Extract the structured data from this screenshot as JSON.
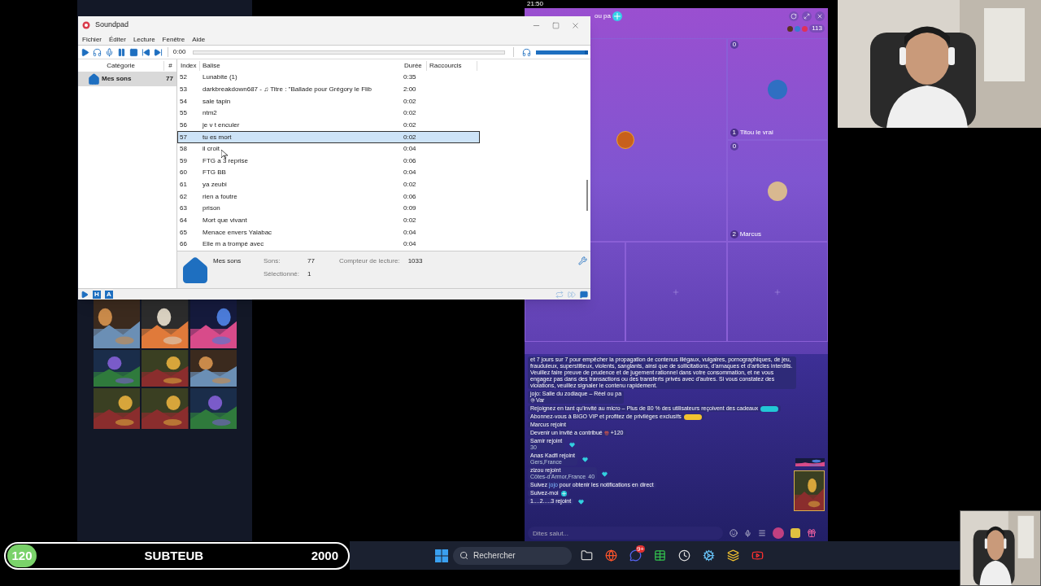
{
  "status_time": "21:50",
  "soundpad": {
    "title": "Soundpad",
    "menu": [
      "Fichier",
      "Éditer",
      "Lecture",
      "Fenêtre",
      "Aide"
    ],
    "toolbar": [
      {
        "kind": "play"
      },
      {
        "kind": "headphones"
      },
      {
        "kind": "mic"
      },
      {
        "kind": "pause"
      },
      {
        "kind": "stop"
      },
      {
        "kind": "previous"
      },
      {
        "kind": "next"
      }
    ],
    "time": "0:00",
    "volume": {
      "level": 1
    },
    "category_columns": [
      "Catégorie",
      "#"
    ],
    "categories": [
      {
        "name": "Mes sons",
        "count": "77",
        "selected": true
      }
    ],
    "columns": [
      "Index",
      "Balise",
      "Durée",
      "Raccourcis"
    ],
    "rows": [
      {
        "index": "52",
        "tag": "Lunabite (1)",
        "duration": "0:35",
        "selected": false
      },
      {
        "index": "53",
        "tag": "darkbreakdown687 - ♫ Titre : \"Ballade pour Grégory le Flib",
        "duration": "2:00",
        "selected": false
      },
      {
        "index": "54",
        "tag": "sale tapin",
        "duration": "0:02",
        "selected": false
      },
      {
        "index": "55",
        "tag": "ntm2",
        "duration": "0:02",
        "selected": false
      },
      {
        "index": "56",
        "tag": "je v t enculer",
        "duration": "0:02",
        "selected": false
      },
      {
        "index": "57",
        "tag": "tu es mort",
        "duration": "0:02",
        "selected": true
      },
      {
        "index": "58",
        "tag": "il croit",
        "duration": "0:04",
        "selected": false
      },
      {
        "index": "59",
        "tag": "FTG a 3 reprise",
        "duration": "0:06",
        "selected": false
      },
      {
        "index": "60",
        "tag": "FTG BB",
        "duration": "0:04",
        "selected": false
      },
      {
        "index": "61",
        "tag": "ya zeubi",
        "duration": "0:02",
        "selected": false
      },
      {
        "index": "62",
        "tag": "rien a foutre",
        "duration": "0:06",
        "selected": false
      },
      {
        "index": "63",
        "tag": "prison",
        "duration": "0:09",
        "selected": false
      },
      {
        "index": "64",
        "tag": "Mort que vivant",
        "duration": "0:02",
        "selected": false
      },
      {
        "index": "65",
        "tag": "Menace envers Yalabac",
        "duration": "0:04",
        "selected": false
      },
      {
        "index": "66",
        "tag": "Elle m a trompé avec",
        "duration": "0:04",
        "selected": false
      }
    ],
    "footer": {
      "category": "Mes sons",
      "stats": [
        {
          "label": "Sons:",
          "value": "77"
        },
        {
          "label": "Compteur de lecture:",
          "value": "1033"
        },
        {
          "label": "Sélectionné:",
          "value": "1"
        }
      ]
    },
    "status_buttons": [
      {
        "kind": "play"
      },
      {
        "kind": "letter",
        "label": "H"
      },
      {
        "kind": "letter",
        "label": "A"
      }
    ]
  },
  "live_room": {
    "title": "ou pa",
    "viewer_count": "113",
    "tiles": [
      {
        "kind": "host"
      },
      {
        "kind": "guest",
        "name": "Titou le vrai",
        "score": "0",
        "seat": "1"
      },
      {
        "kind": "guest",
        "name": "Marcus",
        "score": "0",
        "seat": "2"
      },
      {
        "kind": "covered"
      },
      {
        "kind": "empty"
      },
      {
        "kind": "empty"
      }
    ],
    "chat": [
      {
        "kind": "notice",
        "text": "et 7 jours sur 7 pour empêcher la propagation de contenus illégaux, vulgaires, pornographiques, de jeu, frauduleux, superstitieux, violents, sanglants, ainsi que de sollicitations, d'arnaques et d'articles interdits. Veuillez faire preuve de prudence et de jugement rationnel dans votre consommation, et ne vous engagez pas dans des transactions ou des transferts privés avec d'autres. Si vous constatez des violations, veuillez signaler le contenu rapidement."
      },
      {
        "kind": "room",
        "text": "jojo: Salle du zodiaque – Réel ou pa",
        "location": "Var"
      },
      {
        "kind": "promo",
        "text": "Rejoignez en tant qu'invité au micro – Plus de 80 % des utilisateurs reçoivent des cadeaux",
        "color": "#22c7d6"
      },
      {
        "kind": "promo",
        "text": "Abonnez-vous à BIGO VIP et profitez de privilèges exclusifs",
        "color": "#f2c230"
      },
      {
        "kind": "system",
        "text": "Marcus rejoint"
      },
      {
        "kind": "gift",
        "text": "Devenir un invité a contribué",
        "amount": "+120"
      },
      {
        "kind": "join",
        "text": "Samir rejoint",
        "tags": [
          "30"
        ]
      },
      {
        "kind": "join",
        "text": "Anas Kadfi rejoint",
        "tags": [
          "Gers,France"
        ]
      },
      {
        "kind": "join",
        "text": "zizou rejoint",
        "tags": [
          "Côtes-d'Armor,France",
          "40"
        ]
      },
      {
        "kind": "follow",
        "before": "Suivez ",
        "name": "jojo",
        "after": " pour obtenir les notifications en direct"
      },
      {
        "kind": "follow_button",
        "text": "Suivez-moi"
      },
      {
        "kind": "join",
        "text": "1....2.....3 rejoint"
      }
    ],
    "input": {
      "placeholder": "Dites salut..."
    }
  },
  "goal_bar": {
    "count": "120",
    "name": "SUBTEUB",
    "target": "2000"
  },
  "taskbar": {
    "search_placeholder": "Rechercher",
    "apps": [
      {
        "kind": "files"
      },
      {
        "kind": "browser"
      },
      {
        "kind": "chat",
        "badge": "9+"
      },
      {
        "kind": "sheet"
      },
      {
        "kind": "clock"
      },
      {
        "kind": "steam"
      },
      {
        "kind": "stack"
      },
      {
        "kind": "video"
      }
    ]
  }
}
